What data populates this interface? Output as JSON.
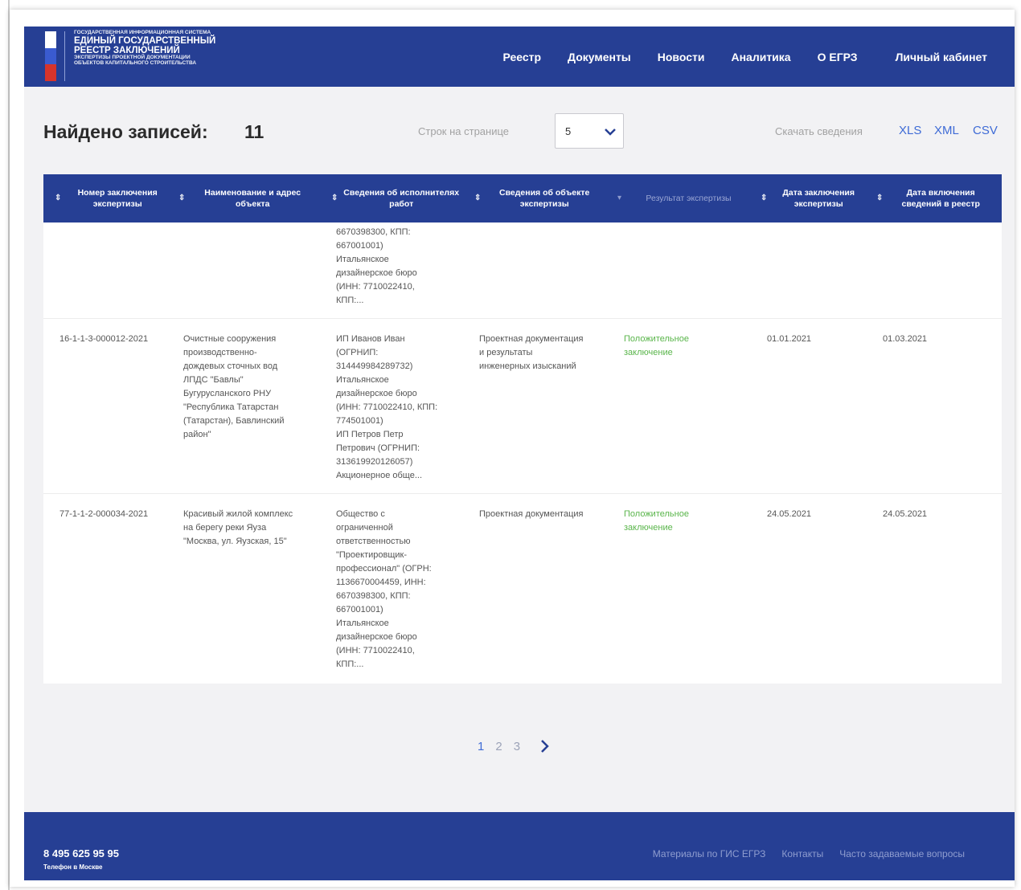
{
  "header": {
    "logo_small_top": "ГОСУДАРСТВЕННАЯ ИНФОРМАЦИОННАЯ СИСТЕМА",
    "logo_line1": "ЕДИНЫЙ ГОСУДАРСТВЕННЫЙ",
    "logo_line2": "РЕЕСТР ЗАКЛЮЧЕНИЙ",
    "logo_small_1": "ЭКСПЕРТИЗЫ ПРОЕКТНОЙ ДОКУМЕНТАЦИИ",
    "logo_small_2": "ОБЪЕКТОВ КАПИТАЛЬНОГО СТРОИТЕЛЬСТВА",
    "flag_colors": [
      "#ffffff",
      "#3a5bd0",
      "#d6342b"
    ],
    "nav": [
      "Реестр",
      "Документы",
      "Новости",
      "Аналитика",
      "О ЕГРЗ",
      "Личный кабинет"
    ]
  },
  "summary": {
    "found_label": "Найдено записей:",
    "found_count": "11",
    "rows_label": "Строк на странице",
    "rows_value": "5",
    "download_label": "Скачать сведения",
    "formats": [
      "XLS",
      "XML",
      "CSV"
    ]
  },
  "table": {
    "columns": [
      "Номер заключения экспертизы",
      "Наименование и адрес объекта",
      "Сведения об исполнителях работ",
      "Сведения об объекте экспертизы",
      "Результат экспертизы",
      "Дата заключения экспертизы",
      "Дата включения сведений в реестр"
    ],
    "partial_row": {
      "executors": "6670398300, КПП:\n667001001)\nИтальянское\nдизайнерское бюро\n(ИНН: 7710022410,\nКПП:..."
    },
    "rows": [
      {
        "number": "16-1-1-3-000012-2021",
        "object": "Очистные сооружения\nпроизводственно-\nдождевых сточных вод\nЛПДС \"Бавлы\"\nБугурусланского РНУ\n\"Республика Татарстан\n(Татарстан), Бавлинский\nрайон\"",
        "executors": "ИП Иванов Иван\n(ОГРНИП:\n314449984289732)\nИтальянское\nдизайнерское бюро\n(ИНН: 7710022410, КПП:\n774501001)\nИП Петров Петр\nПетрович (ОГРНИП:\n313619920126057)\nАкционерное обще...",
        "subject": "Проектная документация\nи результаты\nинженерных изысканий",
        "result": "Положительное\nзаключение",
        "date_conclusion": "01.01.2021",
        "date_registry": "01.03.2021"
      },
      {
        "number": "77-1-1-2-000034-2021",
        "object": "Красивый жилой комплекс\nна берегу реки Яуза\n\"Москва, ул. Яузская, 15\"",
        "executors": "Общество с\nограниченной\nответственностью\n\"Проектировщик-\nпрофессионал\" (ОГРН:\n1136670004459, ИНН:\n6670398300, КПП:\n667001001)\nИтальянское\nдизайнерское бюро\n(ИНН: 7710022410,\nКПП:...",
        "subject": "Проектная документация",
        "result": "Положительное\nзаключение",
        "date_conclusion": "24.05.2021",
        "date_registry": "24.05.2021"
      }
    ]
  },
  "pagination": {
    "pages": [
      "1",
      "2",
      "3"
    ],
    "active": "1"
  },
  "footer": {
    "phone": "8 495 625 95 95",
    "phone_note": "Телефон в Москве",
    "links": [
      "Материалы по ГИС ЕГРЗ",
      "Контакты",
      "Часто задаваемые вопросы"
    ]
  },
  "colors": {
    "brand": "#263f94",
    "link": "#3e6bd6",
    "positive": "#59b54a"
  }
}
